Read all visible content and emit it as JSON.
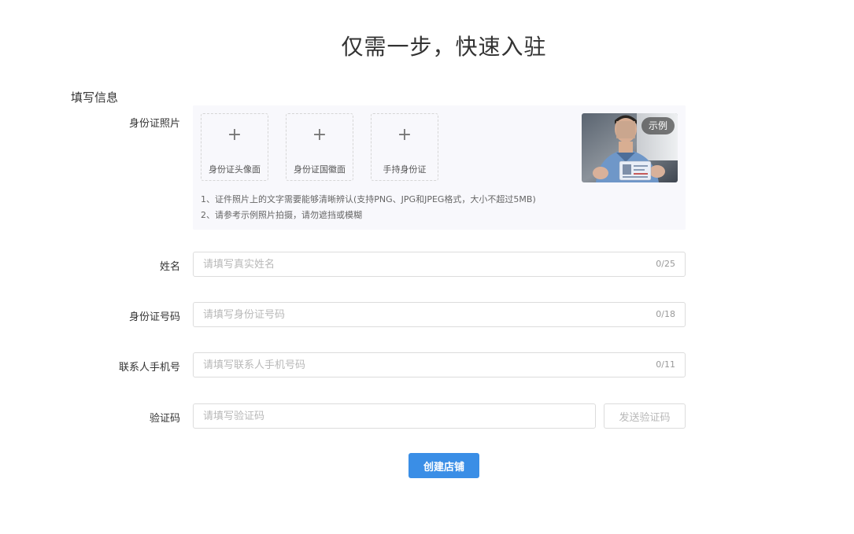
{
  "page": {
    "title": "仅需一步，快速入驻",
    "section_title": "填写信息"
  },
  "id_photo": {
    "label": "身份证照片",
    "upload_front": "身份证头像面",
    "upload_back": "身份证国徽面",
    "upload_hand": "手持身份证",
    "plus_glyph": "+",
    "hint_1": "1、证件照片上的文字需要能够清晰辨认(支持PNG、JPG和JPEG格式，大小不超过5MB)",
    "hint_2": "2、请参考示例照片拍摄，请勿遮挡或模糊",
    "sample_badge": "示例"
  },
  "name": {
    "label": "姓名",
    "placeholder": "请填写真实姓名",
    "value": "",
    "counter": "0/25"
  },
  "id_number": {
    "label": "身份证号码",
    "placeholder": "请填写身份证号码",
    "value": "",
    "counter": "0/18"
  },
  "phone": {
    "label": "联系人手机号",
    "placeholder": "请填写联系人手机号码",
    "value": "",
    "counter": "0/11"
  },
  "code": {
    "label": "验证码",
    "placeholder": "请填写验证码",
    "value": "",
    "send_label": "发送验证码"
  },
  "submit": {
    "label": "创建店铺",
    "color": "#3a8ee6"
  }
}
